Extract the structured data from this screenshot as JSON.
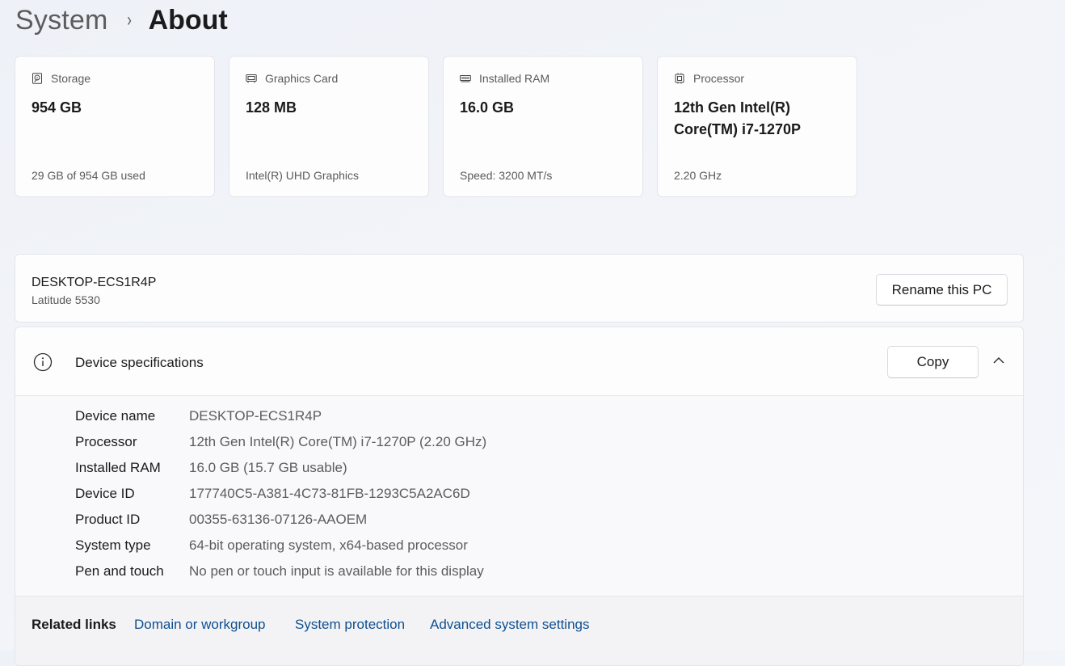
{
  "breadcrumb": {
    "parent": "System",
    "separator": "›",
    "current": "About"
  },
  "cards": [
    {
      "icon": "storage-icon",
      "title": "Storage",
      "value": "954 GB",
      "sub": "29 GB of 954 GB used"
    },
    {
      "icon": "graphics-card-icon",
      "title": "Graphics Card",
      "value": "128 MB",
      "sub": "Intel(R) UHD Graphics"
    },
    {
      "icon": "ram-icon",
      "title": "Installed RAM",
      "value": "16.0 GB",
      "sub": "Speed: 3200 MT/s"
    },
    {
      "icon": "processor-icon",
      "title": "Processor",
      "value": "12th Gen Intel(R) Core(TM) i7-1270P",
      "sub": "2.20 GHz"
    }
  ],
  "pc": {
    "name": "DESKTOP-ECS1R4P",
    "model": "Latitude 5530",
    "rename_label": "Rename this PC"
  },
  "specs": {
    "title": "Device specifications",
    "copy_label": "Copy",
    "rows": [
      {
        "label": "Device name",
        "value": "DESKTOP-ECS1R4P"
      },
      {
        "label": "Processor",
        "value": "12th Gen Intel(R) Core(TM) i7-1270P (2.20 GHz)"
      },
      {
        "label": "Installed RAM",
        "value": "16.0 GB (15.7 GB usable)"
      },
      {
        "label": "Device ID",
        "value": "177740C5-A381-4C73-81FB-1293C5A2AC6D"
      },
      {
        "label": "Product ID",
        "value": "00355-63136-07126-AAOEM"
      },
      {
        "label": "System type",
        "value": "64-bit operating system, x64-based processor"
      },
      {
        "label": "Pen and touch",
        "value": "No pen or touch input is available for this display"
      }
    ]
  },
  "related": {
    "label": "Related links",
    "links": [
      "Domain or workgroup",
      "System protection",
      "Advanced system settings"
    ]
  },
  "colors": {
    "link": "#0f4f90",
    "text_primary": "#1b1b1b",
    "text_secondary": "#5c5c5c"
  }
}
